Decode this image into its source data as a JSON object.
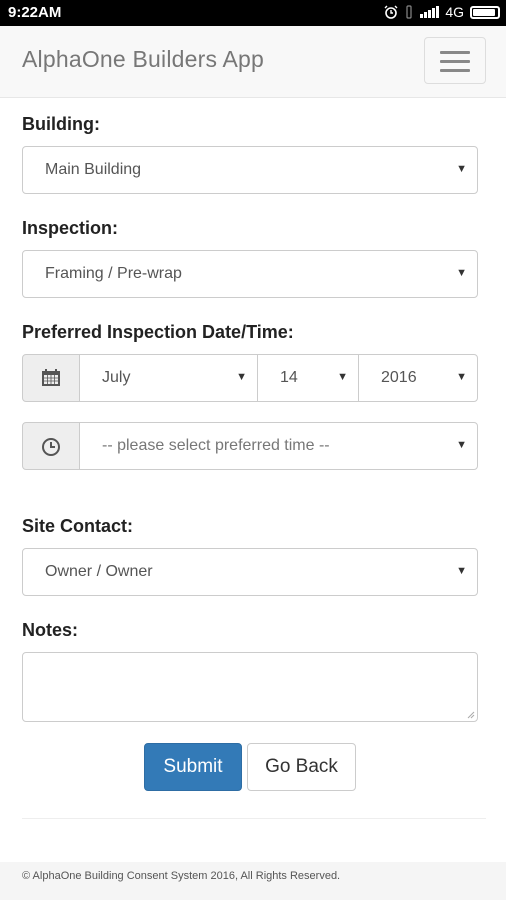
{
  "status_bar": {
    "time": "9:22AM",
    "network": "4G",
    "icons": [
      "alarm-icon",
      "vibrate-icon",
      "signal-icon",
      "battery-icon"
    ]
  },
  "navbar": {
    "brand": "AlphaOne Builders App",
    "menu_icon": "hamburger-menu-icon"
  },
  "form": {
    "building": {
      "label": "Building:",
      "value": "Main Building"
    },
    "inspection": {
      "label": "Inspection:",
      "value": "Framing / Pre-wrap"
    },
    "date_time": {
      "label": "Preferred Inspection Date/Time:",
      "month": "July",
      "day": "14",
      "year": "2016",
      "time_placeholder": "-- please select preferred time --",
      "date_icon": "calendar-icon",
      "time_icon": "clock-icon"
    },
    "site_contact": {
      "label": "Site Contact:",
      "value": "Owner / Owner"
    },
    "notes": {
      "label": "Notes:",
      "value": ""
    },
    "caret": "▼",
    "submit_label": "Submit",
    "back_label": "Go Back"
  },
  "footer": {
    "text": "© AlphaOne Building Consent System 2016, All Rights Reserved."
  },
  "colors": {
    "primary": "#337ab7",
    "navbar_bg": "#f8f8f8",
    "status_bar_bg": "#000000"
  }
}
